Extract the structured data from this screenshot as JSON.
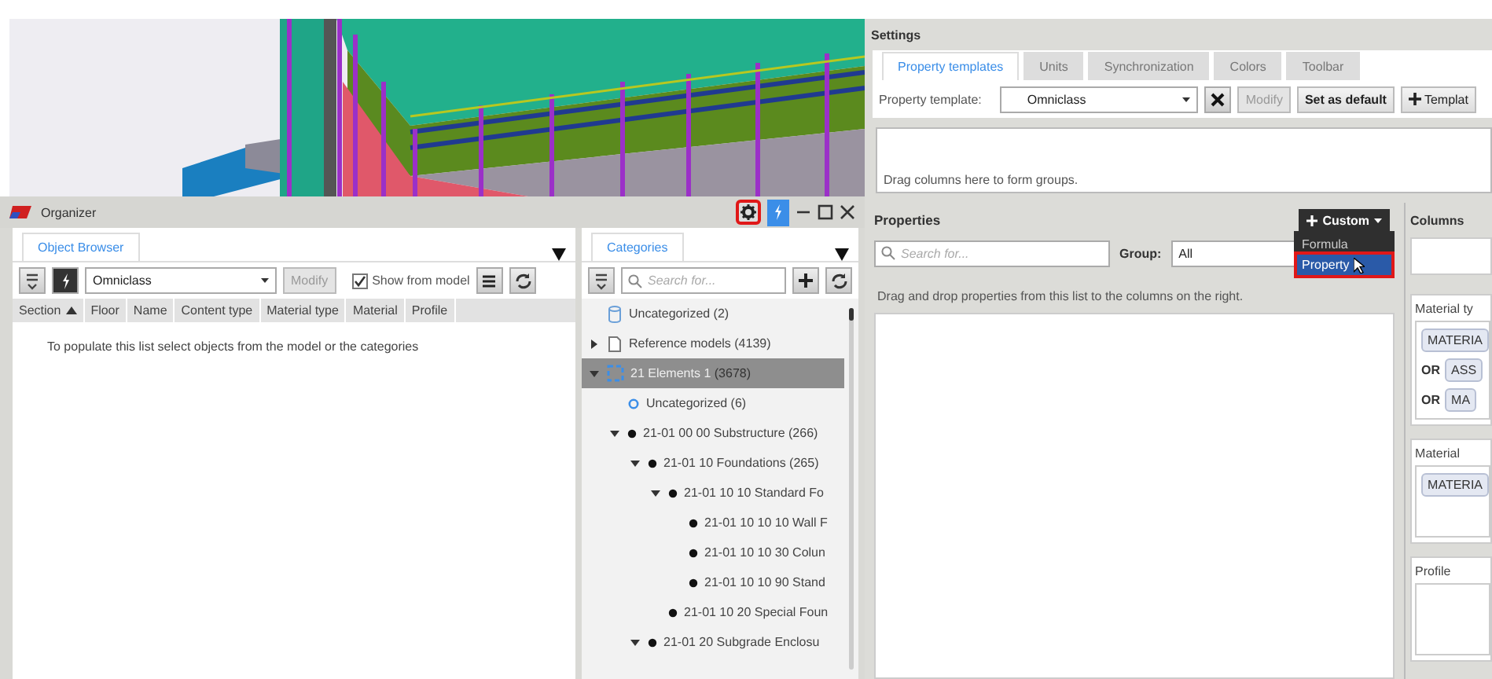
{
  "organizer": {
    "title": "Organizer",
    "settings_button": {
      "highlighted": true
    },
    "object_browser": {
      "tabs": [
        {
          "label": "Object Browser",
          "selected": true
        }
      ],
      "template": "Omniclass",
      "modify": {
        "label": "Modify",
        "disabled": true
      },
      "show_from_model": {
        "label": "Show from model",
        "checked": true
      },
      "columns": [
        {
          "label": "Section",
          "sort_ascending": true
        },
        {
          "label": "Floor"
        },
        {
          "label": "Name"
        },
        {
          "label": "Content type"
        },
        {
          "label": "Material type"
        },
        {
          "label": "Material"
        },
        {
          "label": "Profile"
        }
      ],
      "empty_message": "To populate this list select objects from the model or the categories"
    },
    "categories": {
      "tabs": [
        {
          "label": "Categories",
          "selected": true
        }
      ],
      "search": {
        "placeholder": "Search for..."
      },
      "tree": [
        {
          "label": "Uncategorized (2)",
          "kind": "uncategorized",
          "selected": false
        },
        {
          "label": "Reference models (4139)",
          "kind": "reference",
          "expanded": false,
          "selected": false
        },
        {
          "label": "21 Elements 1",
          "count": "(3678)",
          "kind": "model",
          "expanded": true,
          "selected": true,
          "children": [
            {
              "label": "Uncategorized (6)",
              "kind": "empty",
              "selected": false
            },
            {
              "label": "21-01 00 00 Substructure (266)",
              "kind": "category",
              "expanded": true,
              "selected": false,
              "children": [
                {
                  "label": "21-01 10 Foundations (265)",
                  "kind": "category",
                  "expanded": true,
                  "selected": false,
                  "children": [
                    {
                      "label": "21-01 10 10 Standard Fo",
                      "kind": "category",
                      "expanded": true,
                      "selected": false,
                      "children": [
                        {
                          "label": "21-01 10 10 10 Wall F",
                          "kind": "category",
                          "selected": false
                        },
                        {
                          "label": "21-01 10 10 30 Colun",
                          "kind": "category",
                          "selected": false
                        },
                        {
                          "label": "21-01 10 10 90 Stand",
                          "kind": "category",
                          "selected": false
                        }
                      ]
                    },
                    {
                      "label": "21-01 10 20 Special Foun",
                      "kind": "category",
                      "selected": false
                    }
                  ]
                },
                {
                  "label": "21-01 20  Subgrade Enclosu",
                  "kind": "category",
                  "expanded": true,
                  "selected": false
                }
              ]
            }
          ]
        }
      ]
    }
  },
  "settings": {
    "title": "Settings",
    "tabs": [
      {
        "label": "Property templates",
        "selected": true
      },
      {
        "label": "Units",
        "selected": false
      },
      {
        "label": "Synchronization",
        "selected": false
      },
      {
        "label": "Colors",
        "selected": false
      },
      {
        "label": "Toolbar",
        "selected": false
      }
    ],
    "template_label": "Property template:",
    "template": "Omniclass",
    "buttons": [
      {
        "label": "Modify",
        "kind": "plain",
        "disabled": true
      },
      {
        "label": "Set as default",
        "kind": "plain",
        "disabled": false
      },
      {
        "label": "Templat",
        "kind": "add",
        "disabled": false
      }
    ],
    "group_hint": "Drag columns here to form groups.",
    "properties": {
      "title": "Properties",
      "custom_button": "Custom",
      "custom_menu": [
        {
          "label": "Formula",
          "selected": false,
          "highlighted": false
        },
        {
          "label": "Property",
          "selected": true,
          "highlighted": true
        }
      ],
      "search": {
        "placeholder": "Search for..."
      },
      "group_label": "Group:",
      "group_value": "All",
      "hint": "Drag and drop properties from this list to the columns on the right."
    },
    "columns": {
      "title": "Columns",
      "groups": [
        {
          "title": "Material ty",
          "conditions": [
            {
              "value": "MATERIA"
            },
            {
              "operator": "OR",
              "value": "ASS"
            },
            {
              "operator": "OR",
              "value": "MA"
            }
          ]
        },
        {
          "title": "Material",
          "conditions": [
            {
              "value": "MATERIA"
            }
          ]
        },
        {
          "title": "Profile"
        }
      ]
    }
  }
}
